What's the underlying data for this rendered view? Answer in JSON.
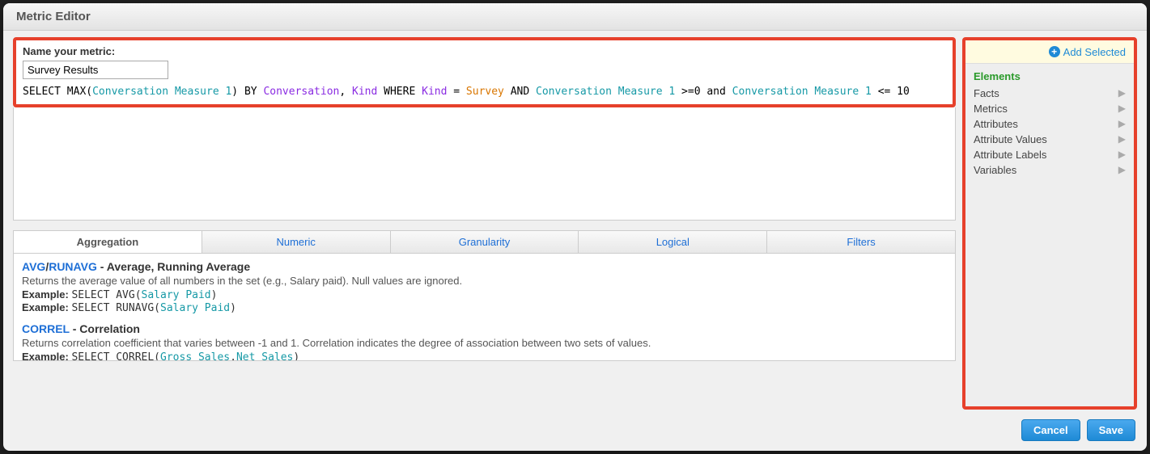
{
  "header": {
    "title": "Metric Editor"
  },
  "name_section": {
    "label": "Name your metric:",
    "value": "Survey Results"
  },
  "query": {
    "parts": {
      "select": "SELECT",
      "max_open": "MAX(",
      "measure1": "Conversation Measure 1",
      "close": ")",
      "by": "BY",
      "conversation": "Conversation",
      "comma": ",",
      "kind": "Kind",
      "where": "WHERE",
      "eq": "=",
      "survey": "Survey",
      "and1": "AND",
      "gte": ">=0 and",
      "lte": "<= 10"
    }
  },
  "tabs": {
    "items": [
      {
        "label": "Aggregation"
      },
      {
        "label": "Numeric"
      },
      {
        "label": "Granularity"
      },
      {
        "label": "Logical"
      },
      {
        "label": "Filters"
      }
    ]
  },
  "functions": [
    {
      "title_links": [
        "AVG",
        "RUNAVG"
      ],
      "title_sep": "/",
      "title_suffix": " - Average, Running Average",
      "desc": "Returns the average value of all numbers in the set (e.g., Salary paid). Null values are ignored.",
      "examples": [
        {
          "label": "Example:",
          "prefix": "SELECT AVG(",
          "params": [
            "Salary Paid"
          ],
          "suffix": ")"
        },
        {
          "label": "Example:",
          "prefix": "SELECT RUNAVG(",
          "params": [
            "Salary Paid"
          ],
          "suffix": ")"
        }
      ]
    },
    {
      "title_links": [
        "CORREL"
      ],
      "title_sep": "",
      "title_suffix": " - Correlation",
      "desc": "Returns correlation coefficient that varies between -1 and 1. Correlation indicates the degree of association between two sets of values.",
      "examples": [
        {
          "label": "Example:",
          "prefix": "SELECT CORREL(",
          "params": [
            "Gross Sales",
            "Net Sales"
          ],
          "suffix": ")"
        }
      ]
    }
  ],
  "sidebar": {
    "add_selected": "Add Selected",
    "header": "Elements",
    "items": [
      {
        "label": "Facts"
      },
      {
        "label": "Metrics"
      },
      {
        "label": "Attributes"
      },
      {
        "label": "Attribute Values"
      },
      {
        "label": "Attribute Labels"
      },
      {
        "label": "Variables"
      }
    ]
  },
  "footer": {
    "cancel": "Cancel",
    "save": "Save"
  }
}
